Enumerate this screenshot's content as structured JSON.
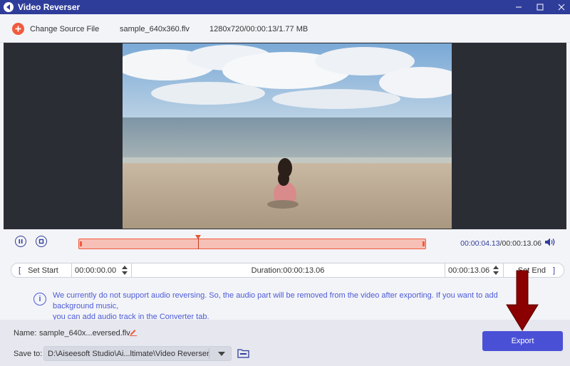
{
  "window": {
    "title": "Video Reverser"
  },
  "header": {
    "change_source_label": "Change Source File",
    "file_name": "sample_640x360.flv",
    "file_info": "1280x720/00:00:13/1.77 MB"
  },
  "playback": {
    "current_time": "00:00:04.13",
    "total_time": "/00:00:13.06",
    "progress": 0.316
  },
  "trim": {
    "set_start_bracket": "[",
    "set_start_label": "Set Start",
    "start_time": "00:00:00.00",
    "duration": "Duration:00:00:13.06",
    "end_time": "00:00:13.06",
    "set_end_label": "Set End",
    "set_end_bracket": "]"
  },
  "notice": {
    "icon": "i",
    "text_line1": "We currently do not support audio reversing. So, the audio part will be removed from the video after exporting. If you want to add background music,",
    "text_line2": "you can add audio track in the Converter tab."
  },
  "output": {
    "name_label": "Name:",
    "name_value": "sample_640x...eversed.flv",
    "save_label": "Save to:",
    "save_path": "D:\\Aiseesoft Studio\\Ai...ltimate\\Video Reverser",
    "export_label": "Export"
  },
  "colors": {
    "titlebar": "#2f3d9a",
    "accent": "#4a50d6",
    "timeline_fill": "#f7c0b6",
    "timeline_border": "#f05a3e",
    "overlay_arrow": "#8b0000"
  }
}
